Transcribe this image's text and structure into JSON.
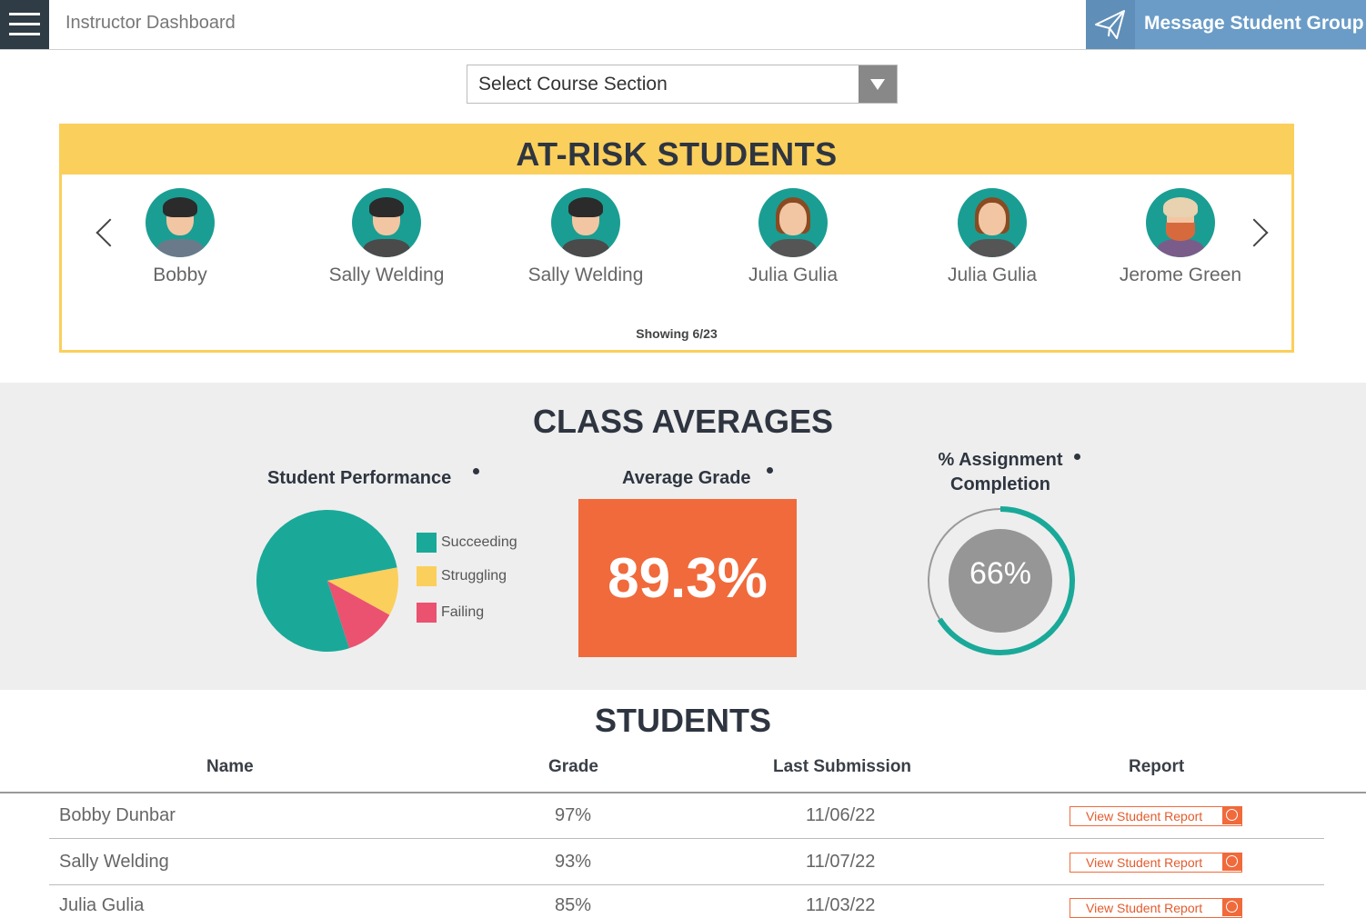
{
  "header": {
    "title": "Instructor Dashboard",
    "message_button_label": "Message Student Group",
    "menu_icon": "hamburger-icon",
    "message_icon": "paper-plane-icon"
  },
  "course_select": {
    "selected": "Select Course Section"
  },
  "at_risk": {
    "title": "AT-RISK STUDENTS",
    "students": [
      {
        "name": "Bobby"
      },
      {
        "name": "Sally Welding"
      },
      {
        "name": "Sally Welding"
      },
      {
        "name": "Julia Gulia"
      },
      {
        "name": "Julia Gulia"
      },
      {
        "name": "Jerome Green"
      }
    ],
    "showing": "Showing 6/23"
  },
  "class_averages": {
    "title": "CLASS AVERAGES",
    "performance": {
      "title": "Student Performance",
      "legend": [
        {
          "label": "Succeeding",
          "color": "#1aa999"
        },
        {
          "label": "Struggling",
          "color": "#fbcf5b"
        },
        {
          "label": "Failing",
          "color": "#ea5270"
        }
      ]
    },
    "average_grade": {
      "title": "Average Grade",
      "value": "89.3%",
      "color": "#f06a3c"
    },
    "completion": {
      "title_line1": "% Assignment",
      "title_line2": "Completion",
      "value": "66%",
      "fraction": 0.66,
      "color": "#1aa999"
    }
  },
  "chart_data": {
    "type": "pie",
    "categories": [
      "Succeeding",
      "Struggling",
      "Failing"
    ],
    "values": [
      77,
      11,
      12
    ],
    "title": "Student Performance"
  },
  "students": {
    "title": "STUDENTS",
    "columns": [
      "Name",
      "Grade",
      "Last Submission",
      "Report"
    ],
    "report_button_label": "View Student Report",
    "rows": [
      {
        "name": "Bobby Dunbar",
        "grade": "97%",
        "last_submission": "11/06/22"
      },
      {
        "name": "Sally Welding",
        "grade": "93%",
        "last_submission": "11/07/22"
      },
      {
        "name": "Julia Gulia",
        "grade": "85%",
        "last_submission": "11/03/22"
      }
    ]
  },
  "colors": {
    "accent_blue": "#6a9cc7",
    "header_dark": "#2f3b45",
    "at_risk_yellow": "#fbcf5b",
    "orange": "#f06a3c",
    "teal": "#1aa999"
  }
}
